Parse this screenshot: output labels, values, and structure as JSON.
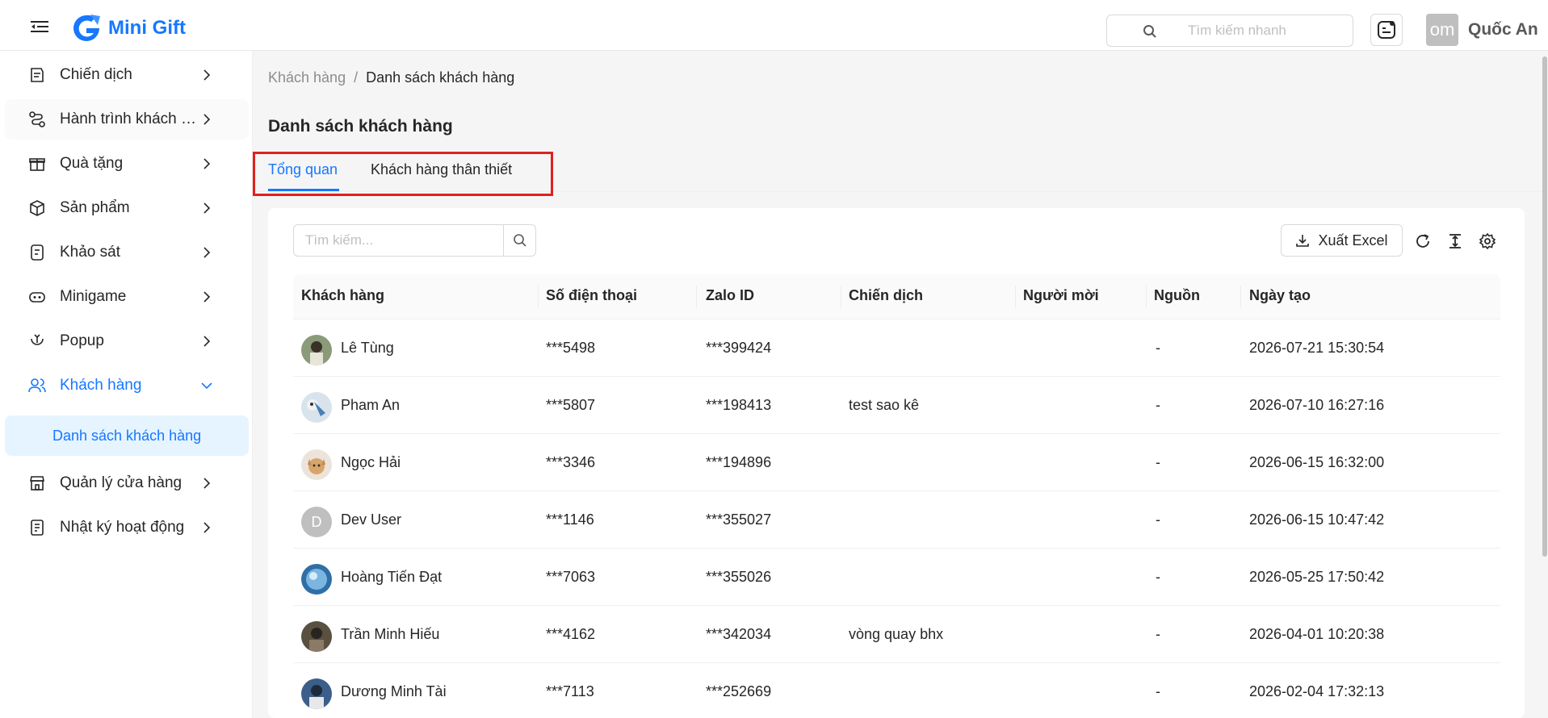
{
  "header": {
    "logo_text": "Mini Gift",
    "search_placeholder": "Tìm kiếm nhanh",
    "avatar_text": "om",
    "user_name": "Quốc An"
  },
  "sidebar": {
    "items": [
      {
        "label": "Chiến dịch",
        "icon": "campaign-icon"
      },
      {
        "label": "Hành trình khách hàng",
        "icon": "journey-icon"
      },
      {
        "label": "Quà tặng",
        "icon": "gift-icon"
      },
      {
        "label": "Sản phẩm",
        "icon": "box-icon"
      },
      {
        "label": "Khảo sát",
        "icon": "survey-icon"
      },
      {
        "label": "Minigame",
        "icon": "gamepad-icon"
      },
      {
        "label": "Popup",
        "icon": "popup-icon"
      },
      {
        "label": "Khách hàng",
        "icon": "users-icon"
      },
      {
        "label": "Quản lý cửa hàng",
        "icon": "store-icon"
      },
      {
        "label": "Nhật ký hoạt động",
        "icon": "log-icon"
      }
    ],
    "sub_item": "Danh sách khách hàng"
  },
  "breadcrumb": {
    "parent": "Khách hàng",
    "separator": "/",
    "current": "Danh sách khách hàng"
  },
  "page": {
    "title": "Danh sách khách hàng",
    "tabs": [
      "Tổng quan",
      "Khách hàng thân thiết"
    ]
  },
  "toolbar": {
    "search_placeholder": "Tìm kiếm...",
    "export_label": "Xuất Excel"
  },
  "table": {
    "columns": [
      "Khách hàng",
      "Số điện thoại",
      "Zalo ID",
      "Chiến dịch",
      "Người mời",
      "Nguồn",
      "Ngày tạo"
    ],
    "rows": [
      {
        "name": "Lê Tùng",
        "phone": "***5498",
        "zalo": "***399424",
        "campaign": "",
        "inviter": "",
        "source": "-",
        "created": "2026-07-21 15:30:54",
        "avatar": "photo"
      },
      {
        "name": "Pham An",
        "phone": "***5807",
        "zalo": "***198413",
        "campaign": "test sao kê",
        "inviter": "",
        "source": "-",
        "created": "2026-07-10 16:27:16",
        "avatar": "photo"
      },
      {
        "name": "Ngọc Hải",
        "phone": "***3346",
        "zalo": "***194896",
        "campaign": "",
        "inviter": "",
        "source": "-",
        "created": "2026-06-15 16:32:00",
        "avatar": "photo"
      },
      {
        "name": "Dev User",
        "phone": "***1146",
        "zalo": "***355027",
        "campaign": "",
        "inviter": "",
        "source": "-",
        "created": "2026-06-15 10:47:42",
        "avatar": "D"
      },
      {
        "name": "Hoàng Tiến Đạt",
        "phone": "***7063",
        "zalo": "***355026",
        "campaign": "",
        "inviter": "",
        "source": "-",
        "created": "2026-05-25 17:50:42",
        "avatar": "photo"
      },
      {
        "name": "Trần Minh Hiếu",
        "phone": "***4162",
        "zalo": "***342034",
        "campaign": "vòng quay bhx",
        "inviter": "",
        "source": "-",
        "created": "2026-04-01 10:20:38",
        "avatar": "photo"
      },
      {
        "name": "Dương Minh Tài",
        "phone": "***7113",
        "zalo": "***252669",
        "campaign": "",
        "inviter": "",
        "source": "-",
        "created": "2026-02-04 17:32:13",
        "avatar": "photo"
      }
    ]
  },
  "colors": {
    "accent": "#1677ff",
    "highlight_box": "#e0201f"
  }
}
